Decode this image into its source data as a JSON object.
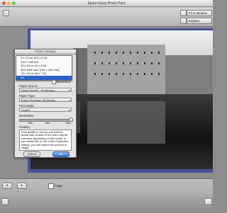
{
  "window": {
    "title": "Epson Easy Photo Print"
  },
  "toolbar": {
    "fit_label": "Fit in Window",
    "add_label": "Add",
    "replace_label": "Replace"
  },
  "dialog": {
    "title": "Printer Settings",
    "paper_size_label": "Paper Size",
    "paper_size_value": "A4",
    "paper_size_options": [
      "9 x 13 cm (3.5 x 5 in)",
      "100 x 148 mm",
      "10 x 15 cm (4 x 6 in)",
      "16:9 wide size (102 x 181 mm)",
      "13 x 18 cm (5 x 7 in)",
      "A4"
    ],
    "borderless_label": "Borderless",
    "paper_source_label": "Paper Source",
    "paper_source_value": "Sheet Feeder - Borderless",
    "paper_type_label": "Paper Type",
    "paper_type_value": "Epson Premium Semigloss",
    "print_mode_label": "Print Mode",
    "print_mode_value": "Quality",
    "borderless_amount_label": "Borderless",
    "min_label": "Min",
    "mid_label": "Mid",
    "max_label": "Max",
    "caution_label": "Caution",
    "caution_text": "Print quality in the top and bottom areas may decline or the area may be smeared depending on the media. If you select Min or Mid in the Expansion setting, you will reduce the amount of image",
    "cancel_label": "Cancel",
    "ok_label": "OK"
  },
  "footer": {
    "page_label": "Page"
  }
}
